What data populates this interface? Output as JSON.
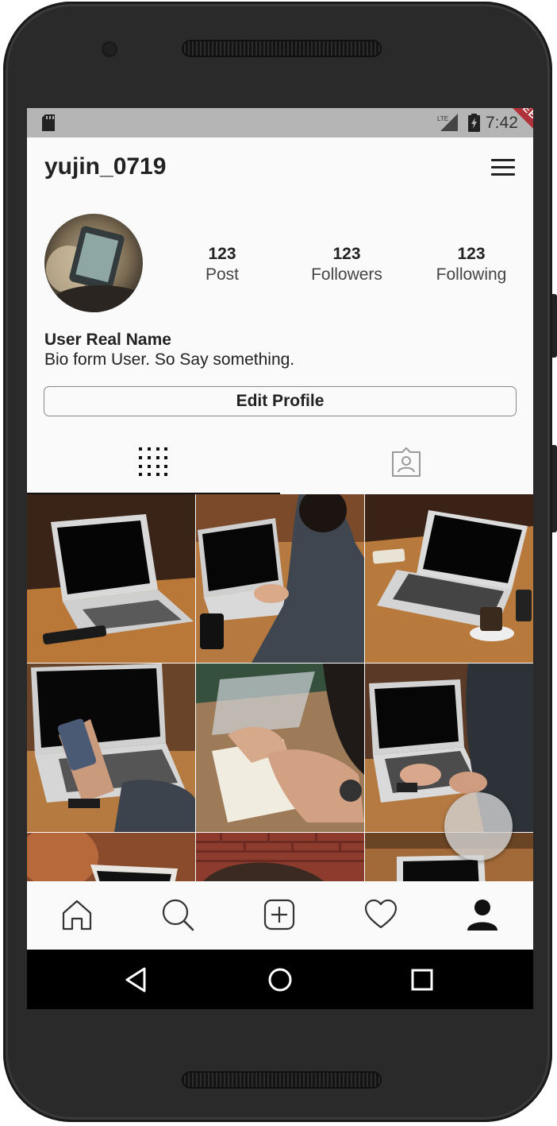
{
  "status_bar": {
    "time": "7:42",
    "network": "LTE",
    "debug_banner": "DEBUG",
    "icons": [
      "sd-card-icon",
      "lte-signal-icon",
      "battery-charging-icon"
    ]
  },
  "app_bar": {
    "title": "yujin_0719",
    "menu_icon": "hamburger-menu-icon"
  },
  "profile": {
    "stats": [
      {
        "value": "123",
        "label": "Post"
      },
      {
        "value": "123",
        "label": "Followers"
      },
      {
        "value": "123",
        "label": "Following"
      }
    ],
    "real_name": "User Real Name",
    "bio": "Bio form User. So Say something.",
    "edit_button": "Edit Profile"
  },
  "tabs": [
    {
      "icon": "grid-icon",
      "selected": true
    },
    {
      "icon": "tagged-person-icon",
      "selected": false
    }
  ],
  "photos_count_visible": 9,
  "bottom_nav": [
    {
      "icon": "home-icon",
      "selected": false
    },
    {
      "icon": "search-icon",
      "selected": false
    },
    {
      "icon": "add-post-icon",
      "selected": false
    },
    {
      "icon": "heart-icon",
      "selected": false
    },
    {
      "icon": "profile-icon",
      "selected": true
    }
  ],
  "system_nav": [
    "back-icon",
    "home-circle-icon",
    "recents-icon"
  ],
  "colors": {
    "status_bar": "#b5b5b5",
    "background": "#fafafa",
    "debug_ribbon": "#b0323a",
    "text": "#222222"
  }
}
